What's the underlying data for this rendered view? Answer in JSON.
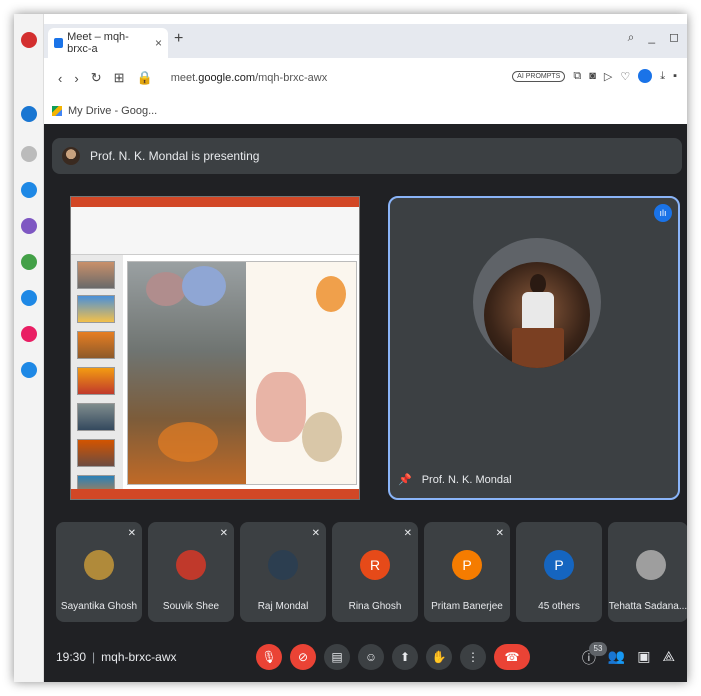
{
  "browser": {
    "tab_title": "Meet – mqh-brxc-a",
    "tab_close": "×",
    "new_tab": "+",
    "url_prefix": "meet.",
    "url_domain": "google.com",
    "url_path": "/mqh-brxc-awx",
    "ai_prompts": "AI PROMPTS",
    "bookmark_label": "My Drive - Goog..."
  },
  "meet": {
    "presenting_text": "Prof. N. K. Mondal is presenting",
    "speaker_name": "Prof. N. K. Mondal",
    "participants": [
      {
        "name": "Sayantika Ghosh",
        "initial": "",
        "color": "#b08a3a"
      },
      {
        "name": "Souvik Shee",
        "initial": "",
        "color": "#c0392b"
      },
      {
        "name": "Raj Mondal",
        "initial": "",
        "color": "#2c3e50"
      },
      {
        "name": "Rina Ghosh",
        "initial": "R",
        "color": "#e64a19"
      },
      {
        "name": "Pritam Banerjee",
        "initial": "P",
        "color": "#f57c00"
      },
      {
        "name": "45 others",
        "initial": "P",
        "color": "#1565c0"
      },
      {
        "name": "Tehatta Sadana...",
        "initial": "",
        "color": "#9e9e9e"
      }
    ],
    "time": "19:30",
    "meeting_code": "mqh-brxc-awx",
    "people_count": "53"
  },
  "colors": {
    "meet_bg": "#202124",
    "tile_bg": "#3c4043",
    "accent": "#1a73e8",
    "end_call": "#ea4335"
  }
}
